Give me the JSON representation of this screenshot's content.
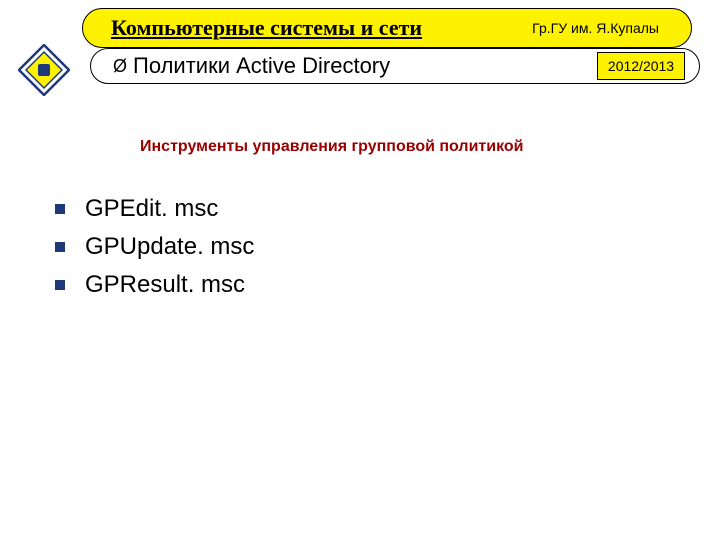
{
  "header": {
    "course_title": "Компьютерные системы и сети",
    "institution": "Гр.ГУ им. Я.Купалы",
    "subtopic": "Политики Active Directory",
    "year": "2012/2013"
  },
  "section_title": "Инструменты управления групповой политикой",
  "tools": [
    "GPEdit. msc",
    "GPUpdate. msc",
    "GPResult. msc"
  ]
}
